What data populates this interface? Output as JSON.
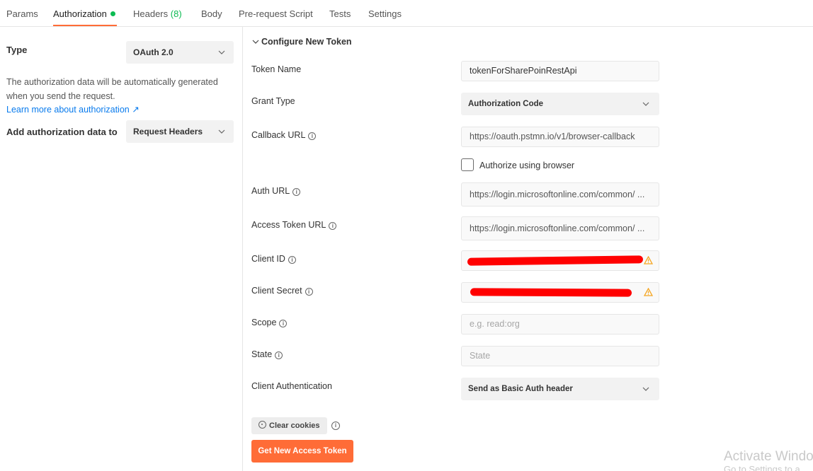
{
  "tabs": [
    {
      "label": "Params"
    },
    {
      "label": "Authorization"
    },
    {
      "label": "Headers",
      "count": "(8)"
    },
    {
      "label": "Body"
    },
    {
      "label": "Pre-request Script"
    },
    {
      "label": "Tests"
    },
    {
      "label": "Settings"
    }
  ],
  "left": {
    "type_label": "Type",
    "type_value": "OAuth 2.0",
    "description": "The authorization data will be automatically generated when you send the request.",
    "learn_link": "Learn more about authorization ↗",
    "add_to_label": "Add authorization data to",
    "add_to_value": "Request Headers"
  },
  "config": {
    "section_title": "Configure New Token",
    "token_name_label": "Token Name",
    "token_name_value": "tokenForSharePoinRestApi",
    "grant_type_label": "Grant Type",
    "grant_type_value": "Authorization Code",
    "callback_url_label": "Callback URL",
    "callback_url_value": "https://oauth.pstmn.io/v1/browser-callback",
    "authorize_browser_label": "Authorize using browser",
    "authorize_browser_checked": false,
    "auth_url_label": "Auth URL",
    "auth_url_value": "https://login.microsoftonline.com/common/ ...",
    "access_token_url_label": "Access Token URL",
    "access_token_url_value": "https://login.microsoftonline.com/common/ ...",
    "client_id_label": "Client ID",
    "client_secret_label": "Client Secret",
    "scope_label": "Scope",
    "scope_placeholder": "e.g. read:org",
    "state_label": "State",
    "state_placeholder": "State",
    "client_auth_label": "Client Authentication",
    "client_auth_value": "Send as Basic Auth header",
    "clear_cookies_label": "Clear cookies",
    "get_token_label": "Get New Access Token"
  },
  "watermark": {
    "line1": "Activate Windo",
    "line2": "Go to Settings to a"
  },
  "colors": {
    "accent": "#ff6c37",
    "active_dot": "#0cbb52",
    "link": "#097bed",
    "warning": "#f5a623",
    "redaction": "#ff0000"
  }
}
